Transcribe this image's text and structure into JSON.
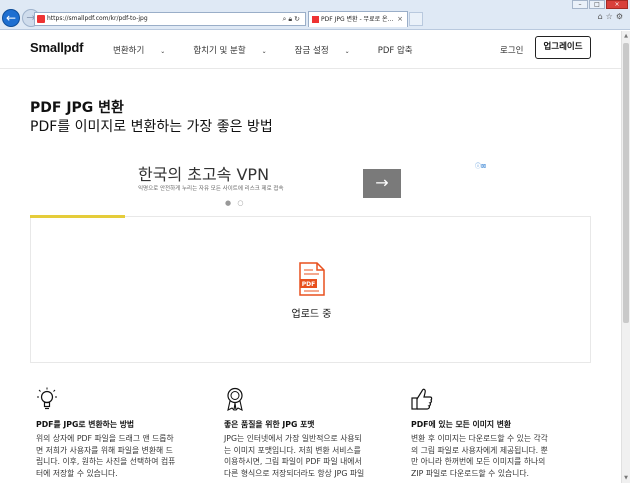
{
  "browser": {
    "url": "https://smallpdf.com/kr/pdf-to-jpg",
    "tab_title": "PDF JPG 변환 - 무료로 온...",
    "tab_close": "×"
  },
  "nav": {
    "logo": "Smallpdf",
    "menu": [
      {
        "label": "변환하기",
        "chevron": "⌄"
      },
      {
        "label": "합치기 및 분할",
        "chevron": "⌄"
      },
      {
        "label": "잠금 설정",
        "chevron": "⌄"
      },
      {
        "label": "PDF 압축",
        "chevron": ""
      }
    ],
    "login": "로그인",
    "upgrade": "업그레이드"
  },
  "hero": {
    "title": "PDF JPG 변환",
    "subtitle": "PDF를 이미지로 변환하는 가장 좋은 방법"
  },
  "ad": {
    "title": "한국의 초고속 VPN",
    "subtitle": "익명으로 안전하게 누리는 자유 모든 사이트에 리스크 제로 접속",
    "arrow": "→",
    "badge": "ⓘ⊠",
    "dots": "● ○"
  },
  "upload": {
    "icon_label": "PDF",
    "status": "업로드 중",
    "progress_fraction": 0.17,
    "accent": "#e5cc3a",
    "pdf_color": "#e8501e"
  },
  "features": [
    {
      "icon": "lightbulb-icon",
      "title": "PDF를 JPG로 변환하는 방법",
      "desc_lines": [
        "위의 상자에 PDF 파일을 드래그 앤 드롭하",
        "면 저희가 사용자를 위해 파일을 변환해 드",
        "립니다. 이후, 원하는 사진을 선택하여 컴퓨",
        "터에 저장할 수 있습니다."
      ]
    },
    {
      "icon": "award-icon",
      "title": "좋은 품질을 위한 JPG 포맷",
      "desc_lines": [
        "JPG는 인터넷에서 가장 일반적으로 사용되",
        "는 이미지 포맷입니다. 저희 변환 서비스를",
        "이용하시면, 그림 파일이 PDF 파일 내에서",
        "다른 형식으로 저장되더라도 항상 JPG 파일"
      ]
    },
    {
      "icon": "thumbs-up-icon",
      "title": "PDF에 있는 모든 이미지 변환",
      "desc_lines": [
        "변환 후 이미지는 다운로드할 수 있는 각각",
        "의 그림 파일로 사용자에게 제공됩니다. 뿐",
        "만 아니라 한꺼번에 모든 이미지를 하나의",
        "ZIP 파일로 다운로드할 수 있습니다."
      ]
    }
  ]
}
